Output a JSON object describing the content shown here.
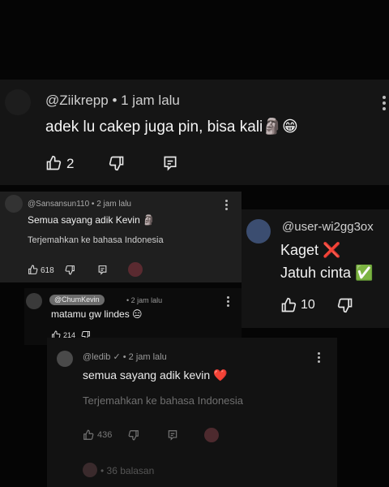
{
  "comments": {
    "main": {
      "handle": "@Ziikrepp • 1 jam lalu",
      "text": "adek lu cakep juga pin, bisa kali🗿😁",
      "likes": "2"
    },
    "sansan": {
      "handle": "@Sansansun110 • 2 jam lalu",
      "text": "Semua sayang adik Kevin 🗿",
      "translate": "Terjemahkan ke bahasa Indonesia",
      "likes": "618"
    },
    "user_wi": {
      "handle": "@user-wi2gg3ox",
      "line1": "Kaget ❌",
      "line2": "Jatuh cinta ✅",
      "likes": "10"
    },
    "chum": {
      "handle": "@ChumKevin",
      "time": "• 2 jam lalu",
      "text": "matamu gw lindes 😑",
      "likes": "214"
    },
    "ledib": {
      "handle": "@ledib ✓ • 2 jam lalu",
      "text": "semua sayang adik kevin ❤️",
      "translate": "Terjemahkan ke bahasa Indonesia",
      "likes": "436",
      "replies": "• 36 balasan"
    }
  },
  "icons": {
    "like": "thumbs-up-icon",
    "dislike": "thumbs-down-icon",
    "reply": "reply-icon",
    "more": "more-vertical-icon"
  }
}
